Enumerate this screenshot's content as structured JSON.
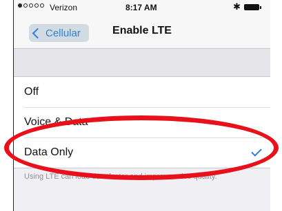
{
  "status_bar": {
    "signal_dots_filled": 1,
    "signal_dots_total": 5,
    "carrier": "Verizon",
    "time": "8:17 AM",
    "bluetooth_icon": "bluetooth-icon",
    "battery_icon": "battery-icon"
  },
  "nav": {
    "back_label": "Cellular",
    "title": "Enable LTE"
  },
  "options": [
    {
      "label": "Off",
      "selected": false
    },
    {
      "label": "Voice & Data",
      "selected": false
    },
    {
      "label": "Data Only",
      "selected": true
    }
  ],
  "footer_note": "Using LTE can load data faster and improve voice quality.",
  "colors": {
    "accent": "#2f7fd1",
    "annotation": "#e8101a",
    "background": "#efeff4"
  }
}
